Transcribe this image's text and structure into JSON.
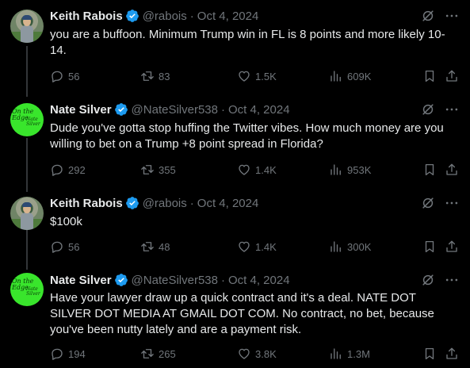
{
  "tweets": [
    {
      "author": "Keith Rabois",
      "handle": "@rabois",
      "separator": "·",
      "date": "Oct 4, 2024",
      "text": "you are a buffoon.  Minimum Trump win in FL is 8 points and more likely 10-14.",
      "replies": "56",
      "reposts": "83",
      "likes": "1.5K",
      "views": "609K"
    },
    {
      "author": "Nate Silver",
      "handle": "@NateSilver538",
      "separator": "·",
      "date": "Oct 4, 2024",
      "text": "Dude you've gotta stop huffing the Twitter vibes. How much money are you willing to bet on a Trump +8 point spread in Florida?",
      "replies": "292",
      "reposts": "355",
      "likes": "1.4K",
      "views": "953K"
    },
    {
      "author": "Keith Rabois",
      "handle": "@rabois",
      "separator": "·",
      "date": "Oct 4, 2024",
      "text": "$100k",
      "replies": "56",
      "reposts": "48",
      "likes": "1.4K",
      "views": "300K"
    },
    {
      "author": "Nate Silver",
      "handle": "@NateSilver538",
      "separator": "·",
      "date": "Oct 4, 2024",
      "text": "Have your lawyer draw up a quick contract and it's a deal. NATE DOT SILVER DOT MEDIA AT GMAIL DOT COM. No contract, no bet, because you've been nutty lately and are a payment risk.",
      "replies": "194",
      "reposts": "265",
      "likes": "3.8K",
      "views": "1.3M"
    }
  ],
  "avatar_text": {
    "nate_top": "On the\nEdge",
    "nate_bottom": "Nate\nSilver"
  },
  "colors": {
    "background": "#000000",
    "text": "#e7e9ea",
    "muted": "#71767b",
    "verified": "#1d9bf0",
    "nate_avatar": "#39e52c",
    "thread_line": "#333639"
  },
  "icons": [
    "verified-badge-icon",
    "grok-icon",
    "more-icon",
    "reply-icon",
    "repost-icon",
    "like-icon",
    "views-icon",
    "bookmark-icon",
    "share-icon"
  ]
}
